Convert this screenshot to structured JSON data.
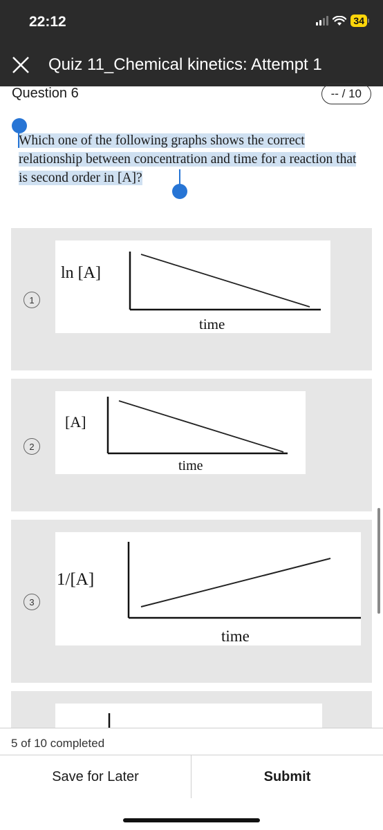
{
  "status_bar": {
    "time": "22:12",
    "battery": "34"
  },
  "header": {
    "title": "Quiz 11_Chemical kinetics: Attempt 1"
  },
  "question": {
    "title": "Question 6",
    "points": "-- / 10",
    "text": "Which one of the following graphs shows the correct relationship between concentration and time for a reaction that is second order in [A]?"
  },
  "options": [
    {
      "number": "1",
      "y_label": "ln [A]",
      "x_label": "time",
      "trend": "decreasing"
    },
    {
      "number": "2",
      "y_label": "[A]",
      "x_label": "time",
      "trend": "decreasing"
    },
    {
      "number": "3",
      "y_label": "1/[A]",
      "x_label": "time",
      "trend": "increasing"
    }
  ],
  "footer": {
    "progress": "5 of 10 completed",
    "save_label": "Save for Later",
    "submit_label": "Submit"
  },
  "colors": {
    "header_bg": "#2b2b2b",
    "selection": "#cfe0f1",
    "handle": "#2775d5",
    "battery": "#ffd60a"
  }
}
